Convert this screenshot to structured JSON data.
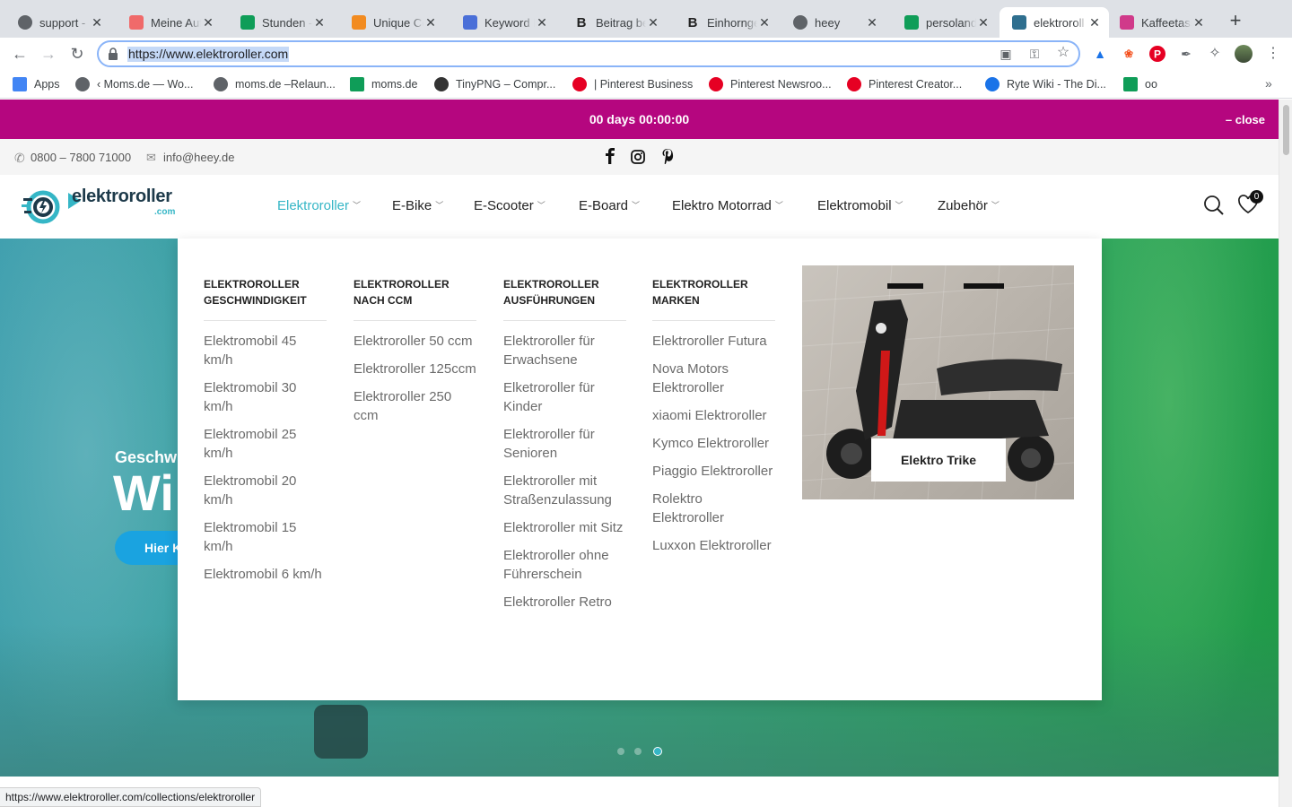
{
  "browser": {
    "tabs": [
      {
        "title": "support - ",
        "favicon": "globe-icon",
        "color": "#5f6368"
      },
      {
        "title": "Meine Auf",
        "favicon": "asana-icon",
        "color": "#f06a6a"
      },
      {
        "title": "Stunden - ",
        "favicon": "sheets-icon",
        "color": "#0f9d58"
      },
      {
        "title": "Unique Co",
        "favicon": "doc-icon",
        "color": "#f28b20"
      },
      {
        "title": "Keyword D",
        "favicon": "chart-icon",
        "color": "#4a6fd8"
      },
      {
        "title": "Beitrag be",
        "favicon": "b-icon",
        "color": "#222222"
      },
      {
        "title": "Einhornge",
        "favicon": "b-icon",
        "color": "#222222"
      },
      {
        "title": "heey",
        "favicon": "globe-icon",
        "color": "#5f6368"
      },
      {
        "title": "persoland",
        "favicon": "sheets-icon",
        "color": "#0f9d58"
      },
      {
        "title": "elektroroll",
        "favicon": "elektroroller-icon",
        "color": "#2f6f8f"
      },
      {
        "title": "Kaffeetass",
        "favicon": "cup-icon",
        "color": "#d03a8a"
      }
    ],
    "url": "https://www.elektroroller.com",
    "bookmarks": [
      {
        "label": "Apps",
        "icon": "apps-grid-icon"
      },
      {
        "label": "‹ Moms.de — Wo...",
        "icon": "globe-icon"
      },
      {
        "label": "moms.de –Relaun...",
        "icon": "globe-icon"
      },
      {
        "label": "moms.de",
        "icon": "sheets-icon"
      },
      {
        "label": "TinyPNG – Compr...",
        "icon": "panda-icon"
      },
      {
        "label": "| Pinterest Business",
        "icon": "pinterest-icon"
      },
      {
        "label": "Pinterest Newsroo...",
        "icon": "pinterest-icon"
      },
      {
        "label": "Pinterest Creator...",
        "icon": "pinterest-icon"
      },
      {
        "label": "Ryte Wiki - The Di...",
        "icon": "ryte-icon"
      },
      {
        "label": "oo",
        "icon": "sheets-icon"
      }
    ],
    "status_url": "https://www.elektroroller.com/collections/elektroroller"
  },
  "promo": {
    "countdown": "00 days 00:00:00",
    "close": "– close"
  },
  "topbar": {
    "phone": "0800 – 7800 71000",
    "email": "info@heey.de"
  },
  "header": {
    "logo_text": "elektroroller",
    "logo_sub": ".com",
    "nav": [
      "Elektroroller",
      "E-Bike",
      "E-Scooter",
      "E-Board",
      "Elektro Motorrad",
      "Elektromobil",
      "Zubehör"
    ],
    "wishlist_count": "0"
  },
  "hero": {
    "subtitle": "Geschw",
    "title": "Wi",
    "button": "Hier K"
  },
  "megamenu": {
    "columns": [
      {
        "heading": "ELEKTROROLLER GESCHWINDIGKEIT",
        "items": [
          "Elektromobil 45 km/h",
          "Elektromobil 30 km/h",
          "Elektromobil 25 km/h",
          "Elektromobil 20 km/h",
          "Elektromobil 15 km/h",
          "Elektromobil 6 km/h"
        ]
      },
      {
        "heading": "ELEKTROROLLER NACH CCM",
        "items": [
          "Elektroroller 50 ccm",
          "Elektroroller 125ccm",
          "Elektroroller 250 ccm"
        ]
      },
      {
        "heading": "ELEKTROROLLER AUSFÜHRUNGEN",
        "items": [
          "Elektroroller für Erwachsene",
          "Elketroroller für Kinder",
          "Elektroroller für Senioren",
          "Elektroroller mit Straßenzulassung",
          "Elektroroller mit Sitz",
          "Elektroroller ohne Führerschein",
          "Elektroroller Retro"
        ]
      },
      {
        "heading": "ELEKTROROLLER MARKEN",
        "items": [
          "Elektroroller Futura",
          "Nova Motors Elektroroller",
          "xiaomi Elektroroller",
          "Kymco Elektroroller",
          "Piaggio Elektroroller",
          "Rolektro Elektroroller",
          "Luxxon Elektroroller"
        ]
      }
    ],
    "promo_label": "Elektro Trike"
  },
  "colors": {
    "accent": "#b5067f",
    "nav_active": "#35b6c6",
    "hero_button": "#1aa3e0"
  }
}
